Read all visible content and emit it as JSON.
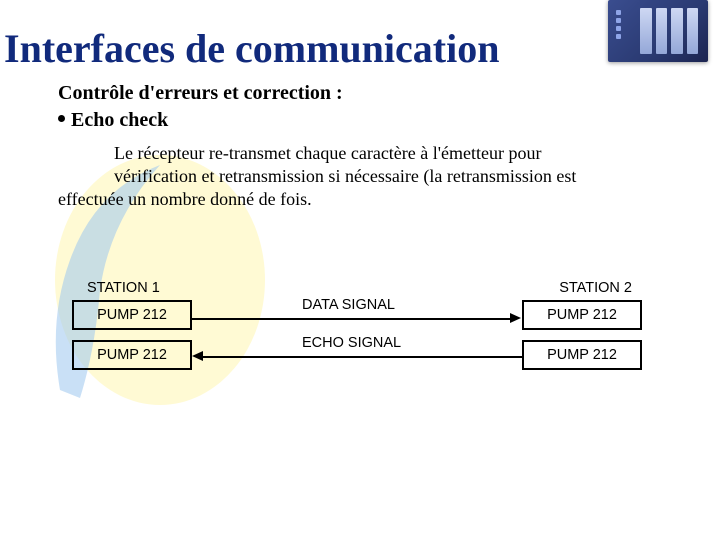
{
  "title": "Interfaces de communication",
  "subtitle": "Contrôle d'erreurs et correction :",
  "topic": "Echo check",
  "body_line1": "Le récepteur re-transmet chaque caractère à l'émetteur pour",
  "body_line2": "vérification et retransmission si nécessaire (la retransmission   est",
  "body_line3": "effectuée un nombre donné de fois.",
  "diagram": {
    "station1": "STATION 1",
    "station2": "STATION 2",
    "pump": "PUMP 212",
    "data_signal": "DATA SIGNAL",
    "echo_signal": "ECHO SIGNAL"
  }
}
